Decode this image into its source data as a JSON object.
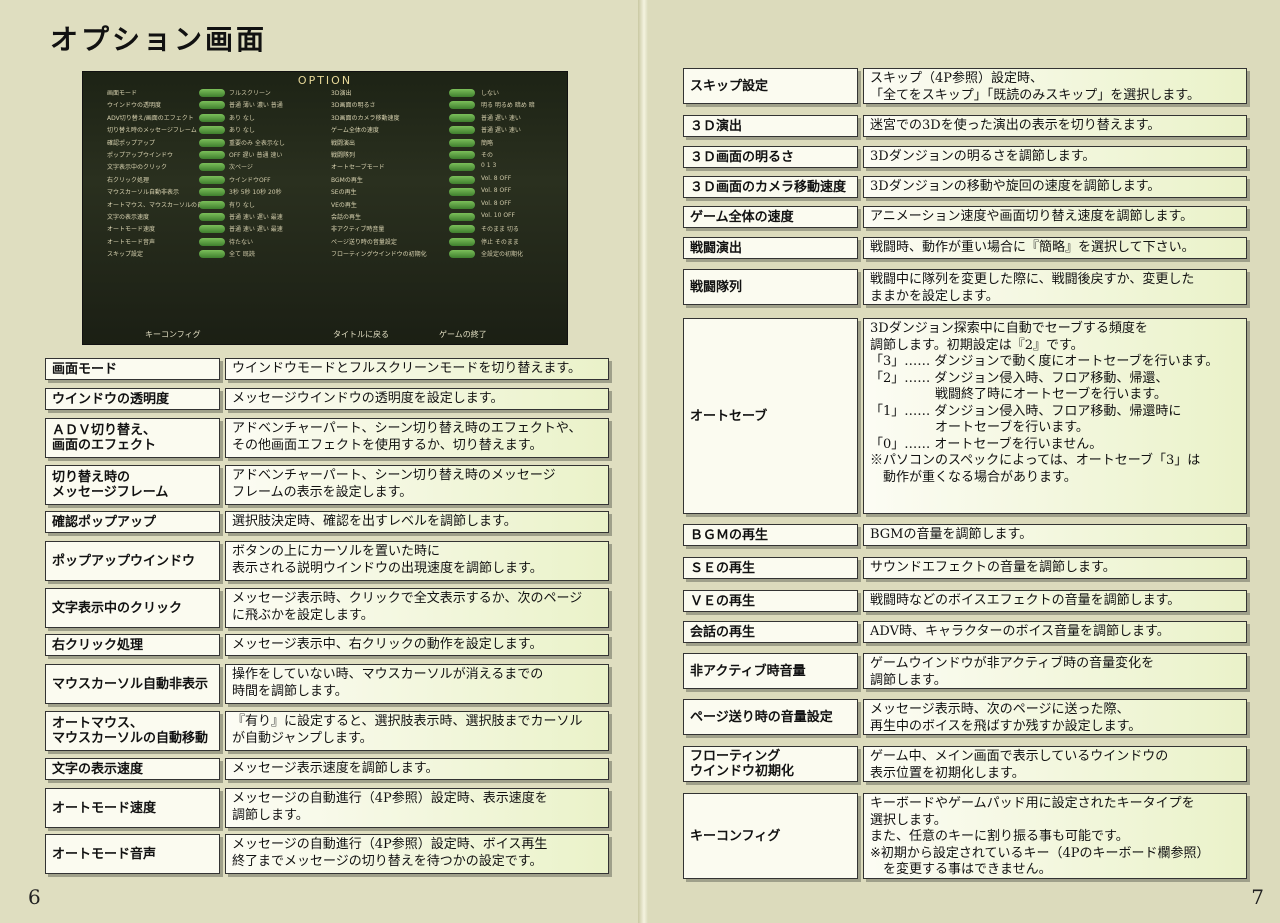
{
  "left_page": {
    "title": "オプション画面",
    "page_number": "6",
    "screenshot": {
      "title": "OPTION",
      "left_settings": [
        {
          "label": "画面モード",
          "value": "フルスクリーン"
        },
        {
          "label": "ウインドウの透明度",
          "value": "普通 薄い 濃い 普通"
        },
        {
          "label": "ADV切り替え/画面のエフェクト",
          "value": "あり なし"
        },
        {
          "label": "切り替え時のメッセージフレーム",
          "value": "あり なし"
        },
        {
          "label": "確認ポップアップ",
          "value": "重要のみ 全表示なし"
        },
        {
          "label": "ポップアップウインドウ",
          "value": "OFF 遅い 普通 速い"
        },
        {
          "label": "文字表示中のクリック",
          "value": "次ページ"
        },
        {
          "label": "右クリック処理",
          "value": "ウインドウOFF"
        },
        {
          "label": "マウスカーソル自動非表示",
          "value": "3秒 5秒 10秒 20秒"
        },
        {
          "label": "オートマウス、マウスカーソルの自動移動",
          "value": "有り なし"
        },
        {
          "label": "文字の表示速度",
          "value": "普通 速い 遅い 最速"
        },
        {
          "label": "オートモード速度",
          "value": "普通 速い 遅い 最速"
        },
        {
          "label": "オートモード音声",
          "value": "待たない"
        },
        {
          "label": "スキップ設定",
          "value": "全て 既読"
        }
      ],
      "right_settings": [
        {
          "label": "3D演出",
          "value": "しない"
        },
        {
          "label": "3D画面の明るさ",
          "value": "明る 明るめ 暗め 暗"
        },
        {
          "label": "3D画面のカメラ移動速度",
          "value": "普通 遅い 速い"
        },
        {
          "label": "ゲーム全体の速度",
          "value": "普通 遅い 速い"
        },
        {
          "label": "戦闘演出",
          "value": "簡略"
        },
        {
          "label": "戦闘隊列",
          "value": "その"
        },
        {
          "label": "オートセーブモード",
          "value": "0 1 3"
        },
        {
          "label": "BGMの再生",
          "value": "Vol. 8 OFF"
        },
        {
          "label": "SEの再生",
          "value": "Vol. 8 OFF"
        },
        {
          "label": "VEの再生",
          "value": "Vol. 8 OFF"
        },
        {
          "label": "会話の再生",
          "value": "Vol. 10 OFF"
        },
        {
          "label": "非アクティブ時音量",
          "value": "そのまま 切る"
        },
        {
          "label": "ページ送り時の音量設定",
          "value": "停止 そのまま"
        },
        {
          "label": "フローティングウインドウの初期化",
          "value": "全設定の初期化"
        }
      ],
      "buttons": [
        "キーコンフィグ",
        "タイトルに戻る",
        "ゲームの終了"
      ]
    },
    "items": [
      {
        "label": "画面モード",
        "desc": "ウインドウモードとフルスクリーンモードを切り替えます。"
      },
      {
        "label": "ウインドウの透明度",
        "desc": "メッセージウインドウの透明度を設定します。"
      },
      {
        "label": "ＡＤＶ切り替え、\n画面のエフェクト",
        "desc": "アドベンチャーパート、シーン切り替え時のエフェクトや、\nその他画面エフェクトを使用するか、切り替えます。"
      },
      {
        "label": "切り替え時の\nメッセージフレーム",
        "desc": "アドベンチャーパート、シーン切り替え時のメッセージ\nフレームの表示を設定します。"
      },
      {
        "label": "確認ポップアップ",
        "desc": "選択肢決定時、確認を出すレベルを調節します。"
      },
      {
        "label": "ポップアップウインドウ",
        "desc": "ボタンの上にカーソルを置いた時に\n表示される説明ウインドウの出現速度を調節します。"
      },
      {
        "label": "文字表示中のクリック",
        "desc": "メッセージ表示時、クリックで全文表示するか、次のページ\nに飛ぶかを設定します。"
      },
      {
        "label": "右クリック処理",
        "desc": "メッセージ表示中、右クリックの動作を設定します。"
      },
      {
        "label": "マウスカーソル自動非表示",
        "desc": "操作をしていない時、マウスカーソルが消えるまでの\n時間を調節します。"
      },
      {
        "label": "オートマウス、\nマウスカーソルの自動移動",
        "desc": "『有り』に設定すると、選択肢表示時、選択肢までカーソル\nが自動ジャンプします。"
      },
      {
        "label": "文字の表示速度",
        "desc": "メッセージ表示速度を調節します。"
      },
      {
        "label": "オートモード速度",
        "desc": "メッセージの自動進行（4P参照）設定時、表示速度を\n調節します。"
      },
      {
        "label": "オートモード音声",
        "desc": "メッセージの自動進行（4P参照）設定時、ボイス再生\n終了までメッセージの切り替えを待つかの設定です。"
      }
    ]
  },
  "right_page": {
    "page_number": "7",
    "items": [
      {
        "label": "スキップ設定",
        "desc": "スキップ（4P参照）設定時、\n「全てをスキップ」「既読のみスキップ」を選択します。"
      },
      {
        "label": "３Ｄ演出",
        "desc": "迷宮での3Dを使った演出の表示を切り替えます。"
      },
      {
        "label": "３Ｄ画面の明るさ",
        "desc": "3Dダンジョンの明るさを調節します。"
      },
      {
        "label": "３Ｄ画面のカメラ移動速度",
        "desc": "3Dダンジョンの移動や旋回の速度を調節します。"
      },
      {
        "label": "ゲーム全体の速度",
        "desc": "アニメーション速度や画面切り替え速度を調節します。"
      },
      {
        "label": "戦闘演出",
        "desc": "戦闘時、動作が重い場合に『簡略』を選択して下さい。"
      },
      {
        "label": "戦闘隊列",
        "desc": "戦闘中に隊列を変更した際に、戦闘後戻すか、変更した\nままかを設定します。"
      },
      {
        "label": "オートセーブ",
        "desc": "3Dダンジョン探索中に自動でセーブする頻度を\n調節します。初期設定は『2』です。\n「3」…… ダンジョンで動く度にオートセーブを行います。\n「2」…… ダンジョン侵入時、フロア移動、帰還、\n　　　　　戦闘終了時にオートセーブを行います。\n「1」…… ダンジョン侵入時、フロア移動、帰還時に\n　　　　　オートセーブを行います。\n「0」…… オートセーブを行いません。\n※パソコンのスペックによっては、オートセーブ「3」は\n　動作が重くなる場合があります。"
      },
      {
        "label": "ＢＧＭの再生",
        "desc": "BGMの音量を調節します。"
      },
      {
        "label": "ＳＥの再生",
        "desc": "サウンドエフェクトの音量を調節します。"
      },
      {
        "label": "ＶＥの再生",
        "desc": "戦闘時などのボイスエフェクトの音量を調節します。"
      },
      {
        "label": "会話の再生",
        "desc": "ADV時、キャラクターのボイス音量を調節します。"
      },
      {
        "label": "非アクティブ時音量",
        "desc": "ゲームウインドウが非アクティブ時の音量変化を\n調節します。"
      },
      {
        "label": "ページ送り時の音量設定",
        "desc": "メッセージ表示時、次のページに送った際、\n再生中のボイスを飛ばすか残すか設定します。"
      },
      {
        "label": "フローティング\nウインドウ初期化",
        "desc": "ゲーム中、メイン画面で表示しているウインドウの\n表示位置を初期化します。"
      },
      {
        "label": "キーコンフィグ",
        "desc": "キーボードやゲームパッド用に設定されたキータイプを\n選択します。\nまた、任意のキーに割り振る事も可能です。\n※初期から設定されているキー（4Pのキーボード欄参照）\n　を変更する事はできません。"
      }
    ]
  }
}
